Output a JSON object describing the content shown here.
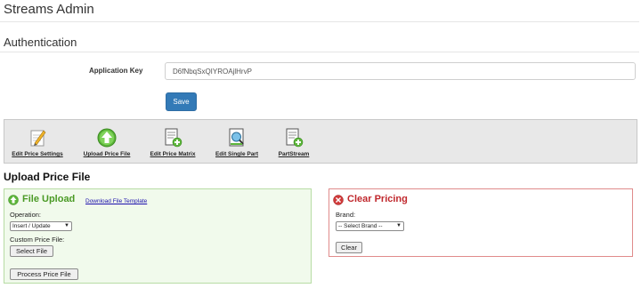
{
  "app": {
    "title": "Streams Admin"
  },
  "auth": {
    "heading": "Authentication",
    "key_label": "Application Key",
    "key_value": "D6fNbqSxQIYROAjlHrvP",
    "save_label": "Save"
  },
  "toolbar": {
    "items": [
      {
        "label": "Edit Price Settings",
        "icon": "pencil-notepad-icon"
      },
      {
        "label": "Upload Price File",
        "icon": "green-up-arrow-icon"
      },
      {
        "label": "Edit Price Matrix",
        "icon": "document-add-icon"
      },
      {
        "label": "Edit Single Part",
        "icon": "document-search-icon"
      },
      {
        "label": "PartStream",
        "icon": "document-add-icon"
      }
    ]
  },
  "upload": {
    "heading": "Upload Price File",
    "panel_title": "File Upload",
    "template_link": "Download File Template",
    "operation_label": "Operation:",
    "operation_value": "Insert / Update",
    "custom_file_label": "Custom Price File:",
    "select_file_label": "Select File",
    "process_label": "Process Price File"
  },
  "clear": {
    "panel_title": "Clear Pricing",
    "brand_label": "Brand:",
    "brand_value": "-- Select Brand --",
    "clear_label": "Clear"
  },
  "colors": {
    "primary": "#337ab7",
    "upload_title": "#4a9a25",
    "clear_title": "#c0282d"
  }
}
